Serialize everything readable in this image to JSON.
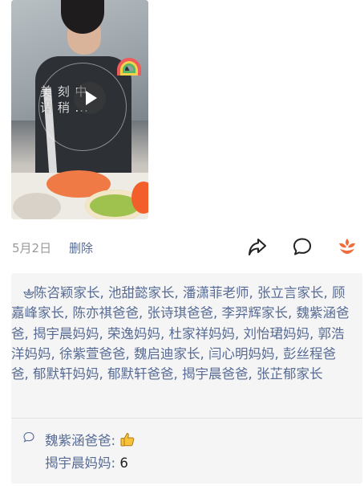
{
  "post": {
    "video": {
      "caption_line1": "美  刻  中",
      "caption_line2": "请  稍  ..."
    },
    "date": "5月2日",
    "delete_label": "删除"
  },
  "actions": {
    "share_icon": "share-icon",
    "comment_icon": "comment-icon",
    "flower_icon": "flower-icon",
    "accent_color": "#f26b3a"
  },
  "likes": {
    "icon": "like-icon",
    "names": "陈咨颖家长, 池甜懿家长, 潘潇菲老师, 张立言家长, 顾嘉峰家长, 陈亦祺爸爸, 张诗琪爸爸, 李羿辉家长, 魏紫涵爸爸, 揭宇晨妈妈, 荣逸妈妈, 杜家祥妈妈, 刘怡珺妈妈, 郭浩洋妈妈, 徐紫萱爸爸, 魏启迪家长, 闫心明妈妈, 彭丝程爸爸, 郁默轩妈妈, 郁默轩爸爸, 揭宇晨爸爸, 张芷郁家长"
  },
  "comments": [
    {
      "name": "魏紫涵爸爸",
      "separator": ":",
      "text": "",
      "emoji": "thumbs-up"
    },
    {
      "name": "揭宇晨妈妈",
      "separator": ":",
      "text": "6"
    }
  ],
  "colors": {
    "link": "#576b95",
    "panel_bg": "#f5f5f5",
    "meta_gray": "#9a9a9a"
  }
}
